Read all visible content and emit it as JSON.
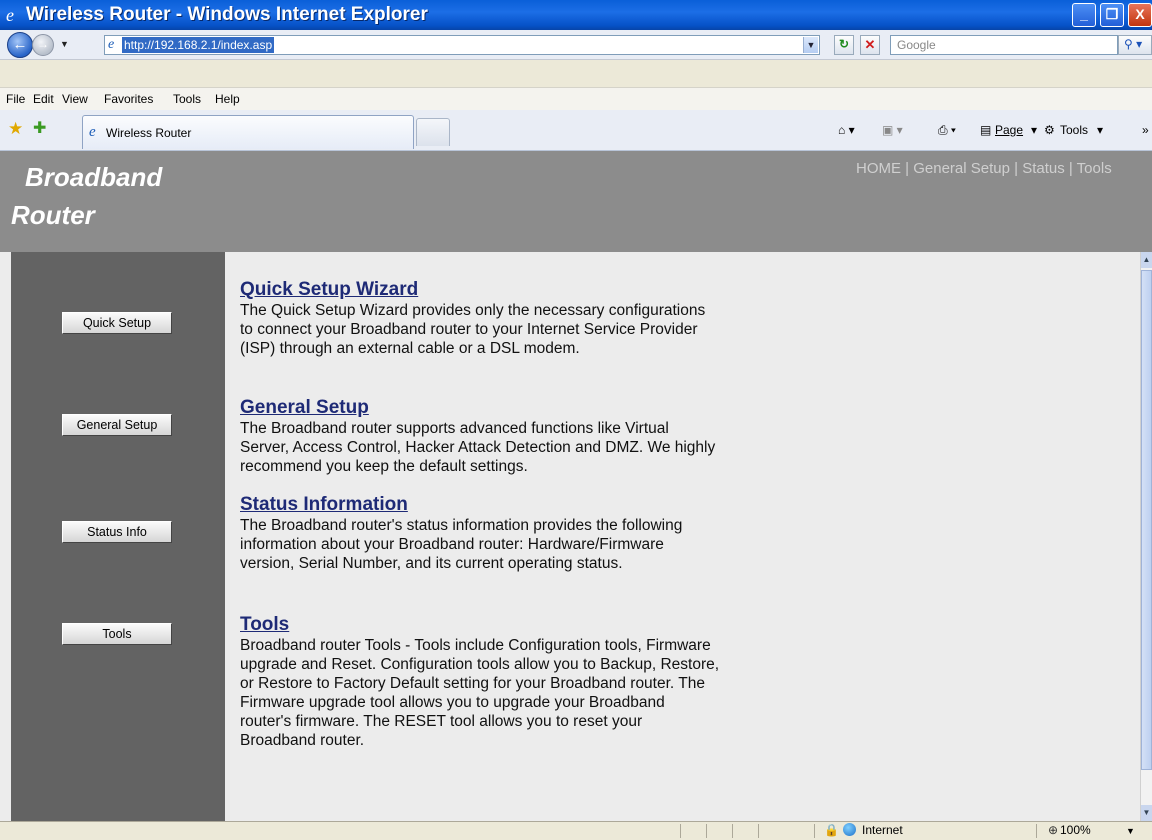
{
  "window": {
    "title": "Wireless Router - Windows Internet Explorer",
    "min_glyph": "_",
    "max_glyph": "❐",
    "close_glyph": "X"
  },
  "address_bar": {
    "url": "http://192.168.2.1/index.asp",
    "search_placeholder": "Google"
  },
  "menu": [
    "File",
    "Edit",
    "View",
    "Favorites",
    "Tools",
    "Help"
  ],
  "tab": {
    "label": "Wireless Router"
  },
  "command_bar": {
    "page_label": "Page",
    "tools_label": "Tools"
  },
  "header": {
    "brand_line1": "Broadband",
    "brand_line2": "Router",
    "topnav": "HOME | General Setup | Status | Tools"
  },
  "sidebar": {
    "buttons": [
      "Quick Setup",
      "General Setup",
      "Status Info",
      "Tools"
    ]
  },
  "sections": [
    {
      "title": "Quick Setup Wizard",
      "body": "The Quick Setup Wizard provides only the necessary configurations to connect your Broadband router to your Internet Service Provider (ISP) through an external cable or a DSL modem."
    },
    {
      "title": "General Setup",
      "body": "The Broadband router supports advanced functions like Virtual Server, Access Control, Hacker Attack Detection and DMZ. We highly recommend you keep the default settings."
    },
    {
      "title": "Status Information",
      "body": "The Broadband router's status information provides the following information about your Broadband router: Hardware/Firmware version, Serial Number, and its current operating status."
    },
    {
      "title": "Tools",
      "body": "Broadband router Tools - Tools include Configuration tools, Firmware upgrade and Reset. Configuration tools allow you to Backup, Restore, or Restore to Factory Default setting for your Broadband router. The Firmware upgrade tool allows you to upgrade your Broadband router's firmware. The RESET tool allows you to reset your Broadband router."
    }
  ],
  "status_bar": {
    "zone": "Internet",
    "zoom": "100%"
  },
  "colors": {
    "title_bar": "#0a5fd8",
    "header_band": "#8c8c8c",
    "sidebar": "#636363",
    "content_bg": "#ececec",
    "section_title": "#1e2a76"
  }
}
